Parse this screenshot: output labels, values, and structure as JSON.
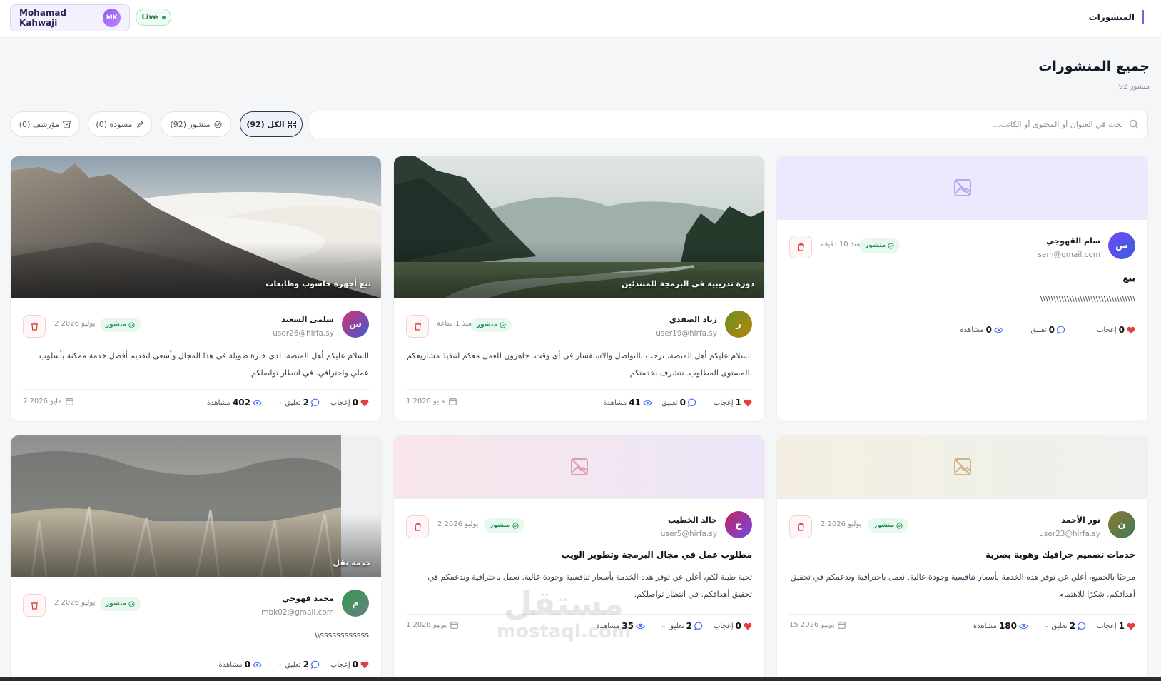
{
  "topbar": {
    "page_name": "المنشورات",
    "user_name": "Mohamad Kahwaji",
    "user_initials": "MK",
    "live_label": "Live"
  },
  "header": {
    "title": "جميع المنشورات",
    "count": "92 منشور"
  },
  "search": {
    "placeholder": "بحث في العنوان أو المحتوى أو الكاتب..."
  },
  "filters": [
    {
      "label": "الكل (92)",
      "icon": "grid-icon",
      "active": true
    },
    {
      "label": "منشور (92)",
      "icon": "check-circle-icon",
      "active": false
    },
    {
      "label": "مسوده (0)",
      "icon": "pencil-icon",
      "active": false
    },
    {
      "label": "مؤرشف (0)",
      "icon": "archive-icon",
      "active": false
    }
  ],
  "colors": {
    "accent": "#7c5cf4",
    "published_bg": "#e8f8ef",
    "published_fg": "#1f8f52",
    "like": "#e53e3e"
  },
  "posts": [
    {
      "author": "سام القهوجي",
      "email": "sam@gmail.com",
      "initial": "س",
      "status": "منشور",
      "time": "منذ 10 دقيقة",
      "title": "بيع",
      "body": "\\\\\\\\\\\\\\\\\\\\\\\\\\\\\\\\\\\\\\\\\\\\\\\\\\\\\\\\\\\\\\\\\\\\\\\\",
      "likes": "0",
      "likes_label": "إعجاب",
      "comments": "0",
      "comments_label": "تعليق",
      "views": "0",
      "views_label": "مشاهدة",
      "image": "none"
    },
    {
      "author": "زياد الصفدي",
      "email": "user19@hirfa.sy",
      "initial": "ز",
      "status": "منشور",
      "time": "منذ 1 ساعة",
      "image_title": "دورة تدريبية في البرمجة للمبتدئين",
      "body": "السلام عليكم أهل المنصة، نرحب بالتواصل والاستفسار في أي وقت. جاهزون للعمل معكم لتنفيذ مشاريعكم بالمستوى المطلوب. نتشرف بخدمتكم.",
      "likes": "1",
      "likes_label": "إعجاب",
      "comments": "0",
      "comments_label": "تعليق",
      "views": "41",
      "views_label": "مشاهدة",
      "footer_date": "1 مايو 2026",
      "image": "forest-river"
    },
    {
      "author": "سلمى السعيد",
      "email": "user26@hirfa.sy",
      "initial": "س",
      "status": "منشور",
      "time": "2 يوليو 2026",
      "image_title": "بيع أجهزة حاسوب وطابعات",
      "body": "السلام عليكم أهل المنصة، لدي خبرة طويلة في هذا المجال وأسعى لتقديم أفضل خدمة ممكنة بأسلوب عملي واحترافي. في انتظار تواصلكم.",
      "likes": "0",
      "likes_label": "إعجاب",
      "comments": "2",
      "comments_label": "تعليق",
      "views": "402",
      "views_label": "مشاهدة",
      "footer_date": "7 مايو 2026",
      "image": "mountain-clouds"
    },
    {
      "author": "نور الأحمد",
      "email": "user23@hirfa.sy",
      "initial": "ن",
      "status": "منشور",
      "time": "2 يوليو 2026",
      "title": "خدمات تصميم جرافيك وهوية بصرية",
      "body": "مرحبًا بالجميع، أعلن عن توفر هذه الخدمة بأسعار تنافسية وجودة عالية. نعمل باحترافية وندعمكم في تحقيق أهدافكم. شكرًا للاهتمام.",
      "likes": "1",
      "likes_label": "إعجاب",
      "comments": "2",
      "comments_label": "تعليق",
      "views": "180",
      "views_label": "مشاهدة",
      "footer_date": "15 يونيو 2026",
      "image": "none"
    },
    {
      "author": "خالد الخطيب",
      "email": "user5@hirfa.sy",
      "initial": "خ",
      "status": "منشور",
      "time": "2 يوليو 2026",
      "title": "مطلوب عمل في مجال البرمجة وتطوير الويب",
      "body": "تحية طيبة لكم، أعلن عن توفر هذه الخدمة بأسعار تنافسية وجودة عالية. نعمل باحترافية وندعمكم في تحقيق أهدافكم. في انتظار تواصلكم.",
      "likes": "0",
      "likes_label": "إعجاب",
      "comments": "2",
      "comments_label": "تعليق",
      "views": "35",
      "views_label": "مشاهدة",
      "footer_date": "1 يونيو 2026",
      "image": "none"
    },
    {
      "author": "محمد قهوجي",
      "email": "mbk02@gmail.com",
      "initial": "م",
      "status": "منشور",
      "time": "2 يوليو 2026",
      "image_title": "خدمة نقل",
      "body": "\\\\ssssssssssss",
      "likes": "0",
      "likes_label": "إعجاب",
      "comments": "2",
      "comments_label": "تعليق",
      "views": "0",
      "views_label": "مشاهدة",
      "image": "frost-forest"
    }
  ],
  "watermark": {
    "ar": "مستقل",
    "en": "mostaql.com"
  }
}
